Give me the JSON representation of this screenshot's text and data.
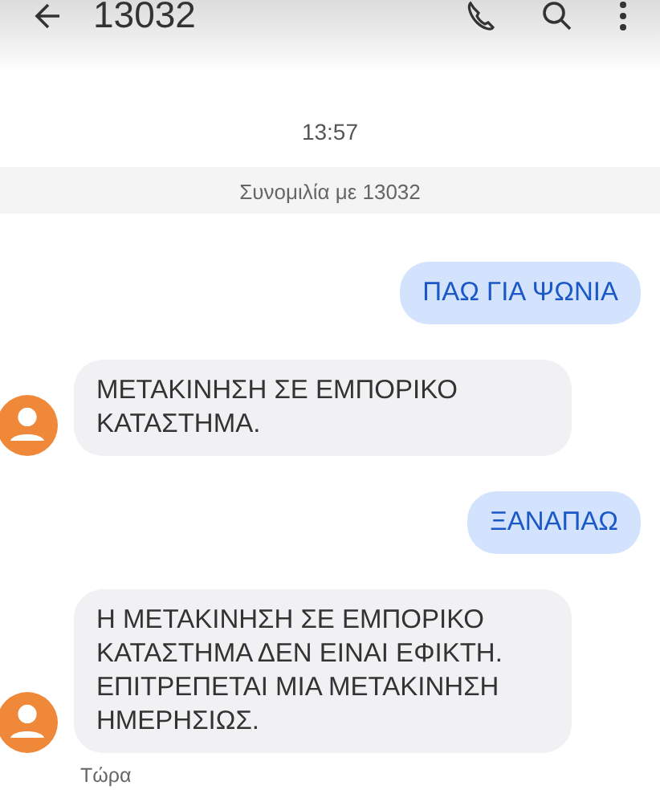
{
  "app_bar": {
    "title": "13032"
  },
  "timestamp": "13:57",
  "conversation_banner": "Συνομιλία με 13032",
  "messages": [
    {
      "kind": "outgoing",
      "text": "ΠΑΩ ΓΙΑ ΨΩΝΙΑ"
    },
    {
      "kind": "incoming",
      "text": "ΜΕΤΑΚΙΝΗΣΗ ΣΕ ΕΜΠΟΡΙΚΟ ΚΑΤΑΣΤΗΜΑ."
    },
    {
      "kind": "outgoing",
      "text": "ΞΑΝΑΠΑΩ"
    },
    {
      "kind": "incoming",
      "text": "Η ΜΕΤΑΚΙΝΗΣΗ ΣΕ ΕΜΠΟΡΙΚΟ ΚΑΤΑΣΤΗΜΑ ΔΕΝ ΕΙΝΑΙ ΕΦΙΚΤΗ. ΕΠΙΤΡΕΠΕΤΑΙ ΜΙΑ ΜΕΤΑΚΙΝΗΣΗ ΗΜΕΡΗΣΙΩΣ.",
      "time": "Τώρα"
    }
  ]
}
